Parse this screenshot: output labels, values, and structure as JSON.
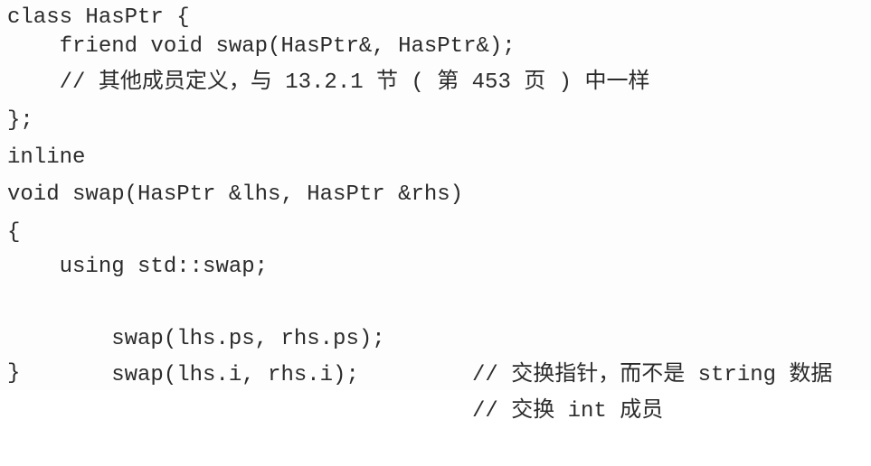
{
  "code": {
    "line1": "class HasPtr {",
    "line2": "    friend void swap(HasPtr&, HasPtr&);",
    "line3": "    // 其他成员定义，与 13.2.1 节 ( 第 453 页 ) 中一样",
    "line4": "};",
    "line5": "inline",
    "line6": "void swap(HasPtr &lhs, HasPtr &rhs)",
    "line7": "{",
    "line8": "    using std::swap;",
    "line9_code": "    swap(lhs.ps, rhs.ps);",
    "line9_comment": "// 交换指针，而不是 string 数据",
    "line10_code": "    swap(lhs.i, rhs.i);",
    "line10_comment": "// 交换 int 成员",
    "line11": "}"
  }
}
